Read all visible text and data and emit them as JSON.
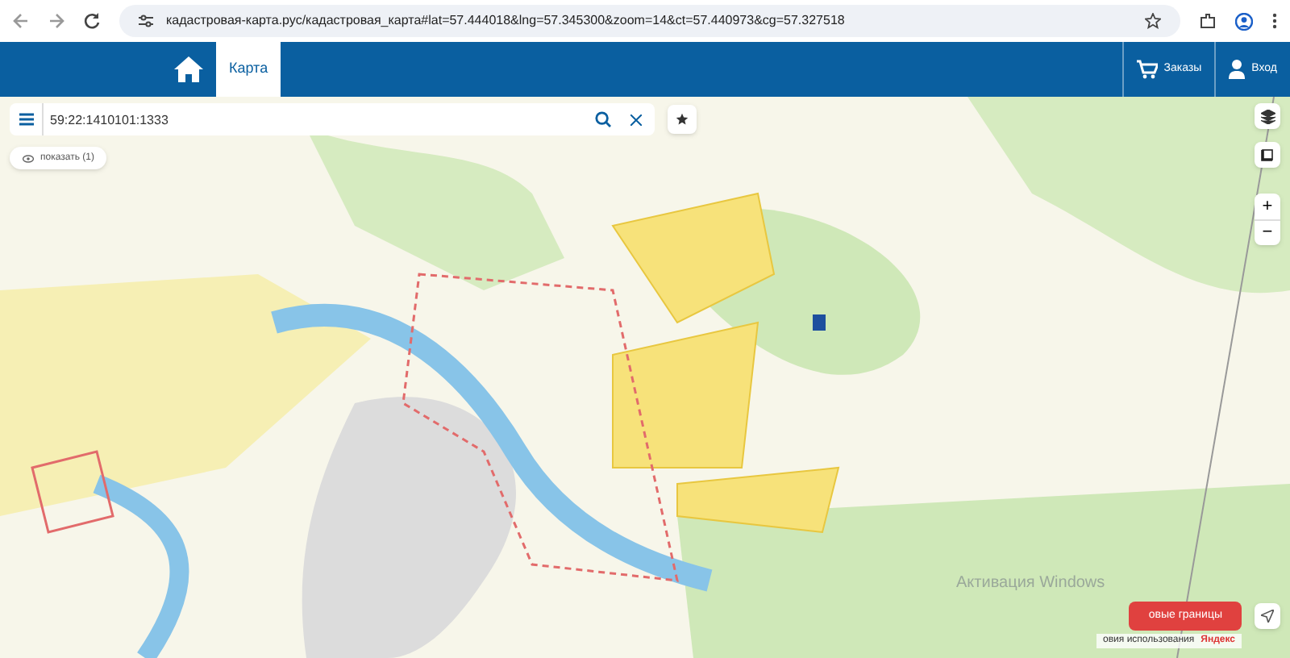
{
  "browser": {
    "url": "кадастровая-карта.рус/кадастровая_карта#lat=57.444018&lng=57.345300&zoom=14&ct=57.440973&cg=57.327518"
  },
  "nav": {
    "tabs": [
      {
        "label": "Карта",
        "selected": true
      }
    ],
    "actions": [
      {
        "kind": "cart",
        "label": "Заказы"
      },
      {
        "kind": "user",
        "label": "Вход"
      }
    ]
  },
  "search": {
    "value": "59:22:1410101:1333"
  },
  "show_button": {
    "label": "показать (1)"
  },
  "map_controls": {
    "zoom_in": "+",
    "zoom_out": "−"
  },
  "os_notice": {
    "title": "Активация Windows"
  },
  "map_footer": {
    "red_button": "овые границы",
    "terms": "овия использования",
    "provider": "Яндекс"
  }
}
